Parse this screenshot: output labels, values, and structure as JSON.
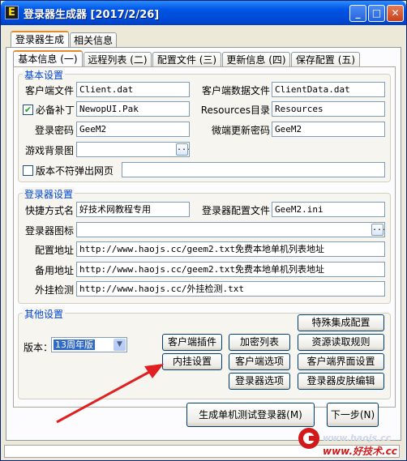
{
  "window": {
    "title": "登录器生成器 [2017/2/26]",
    "app_icon": "E"
  },
  "main_tabs": [
    {
      "label": "登录器生成"
    },
    {
      "label": "相关信息"
    }
  ],
  "sub_tabs": [
    {
      "label": "基本信息 (一)"
    },
    {
      "label": "远程列表 (二)"
    },
    {
      "label": "配置文件 (三)"
    },
    {
      "label": "更新信息 (四)"
    },
    {
      "label": "保存配置 (五)"
    }
  ],
  "basic": {
    "title": "基本设置",
    "client_file_label": "客户端文件",
    "client_file_value": "Client.dat",
    "client_data_label": "客户端数据文件",
    "client_data_value": "ClientData.dat",
    "patch_label": "必备补丁",
    "patch_checked": true,
    "patch_value": "NewopUI.Pak",
    "resources_label": "Resources目录",
    "resources_value": "Resources",
    "login_pwd_label": "登录密码",
    "login_pwd_value": "GeeM2",
    "update_pwd_label": "微端更新密码",
    "update_pwd_value": "GeeM2",
    "bg_label": "游戏背景图",
    "bg_value": "",
    "popup_label": "版本不符弹出网页",
    "popup_checked": false,
    "popup_value": ""
  },
  "launcher": {
    "title": "登录器设置",
    "shortcut_label": "快捷方式名",
    "shortcut_value": "好技术网教程专用",
    "config_file_label": "登录器配置文件",
    "config_file_value": "GeeM2.ini",
    "icon_label": "登录器图标",
    "icon_value": "",
    "config_url_label": "配置地址",
    "config_url_value": "http://www.haojs.cc/geem2.txt免费本地单机列表地址",
    "backup_url_label": "备用地址",
    "backup_url_value": "http://www.haojs.cc/geem2.txt免费本地单机列表地址",
    "cheat_label": "外挂检测",
    "cheat_value": "http://www.haojs.cc/外挂检测.txt"
  },
  "other": {
    "title": "其他设置",
    "version_label": "版本：",
    "version_value": "13周年版",
    "buttons": {
      "special": "特殊集成配置",
      "client_plugin": "客户端插件",
      "encrypt_list": "加密列表",
      "resource_rules": "资源读取规则",
      "builtin_settings": "内挂设置",
      "client_options": "客户端选项",
      "client_ui": "客户端界面设置",
      "launcher_options": "登录器选项",
      "launcher_skin": "登录器皮肤编辑"
    }
  },
  "footer": {
    "generate_label": "生成单机测试登录器(M)",
    "next_label": "下一步(N)"
  },
  "ellipsis": "...",
  "watermark": {
    "url": "www.haojs.cc",
    "name": "www.好技术.cc"
  },
  "colors": {
    "accent": "#0046d5",
    "arrow": "#e02020",
    "watermark": "#d21a1a"
  }
}
